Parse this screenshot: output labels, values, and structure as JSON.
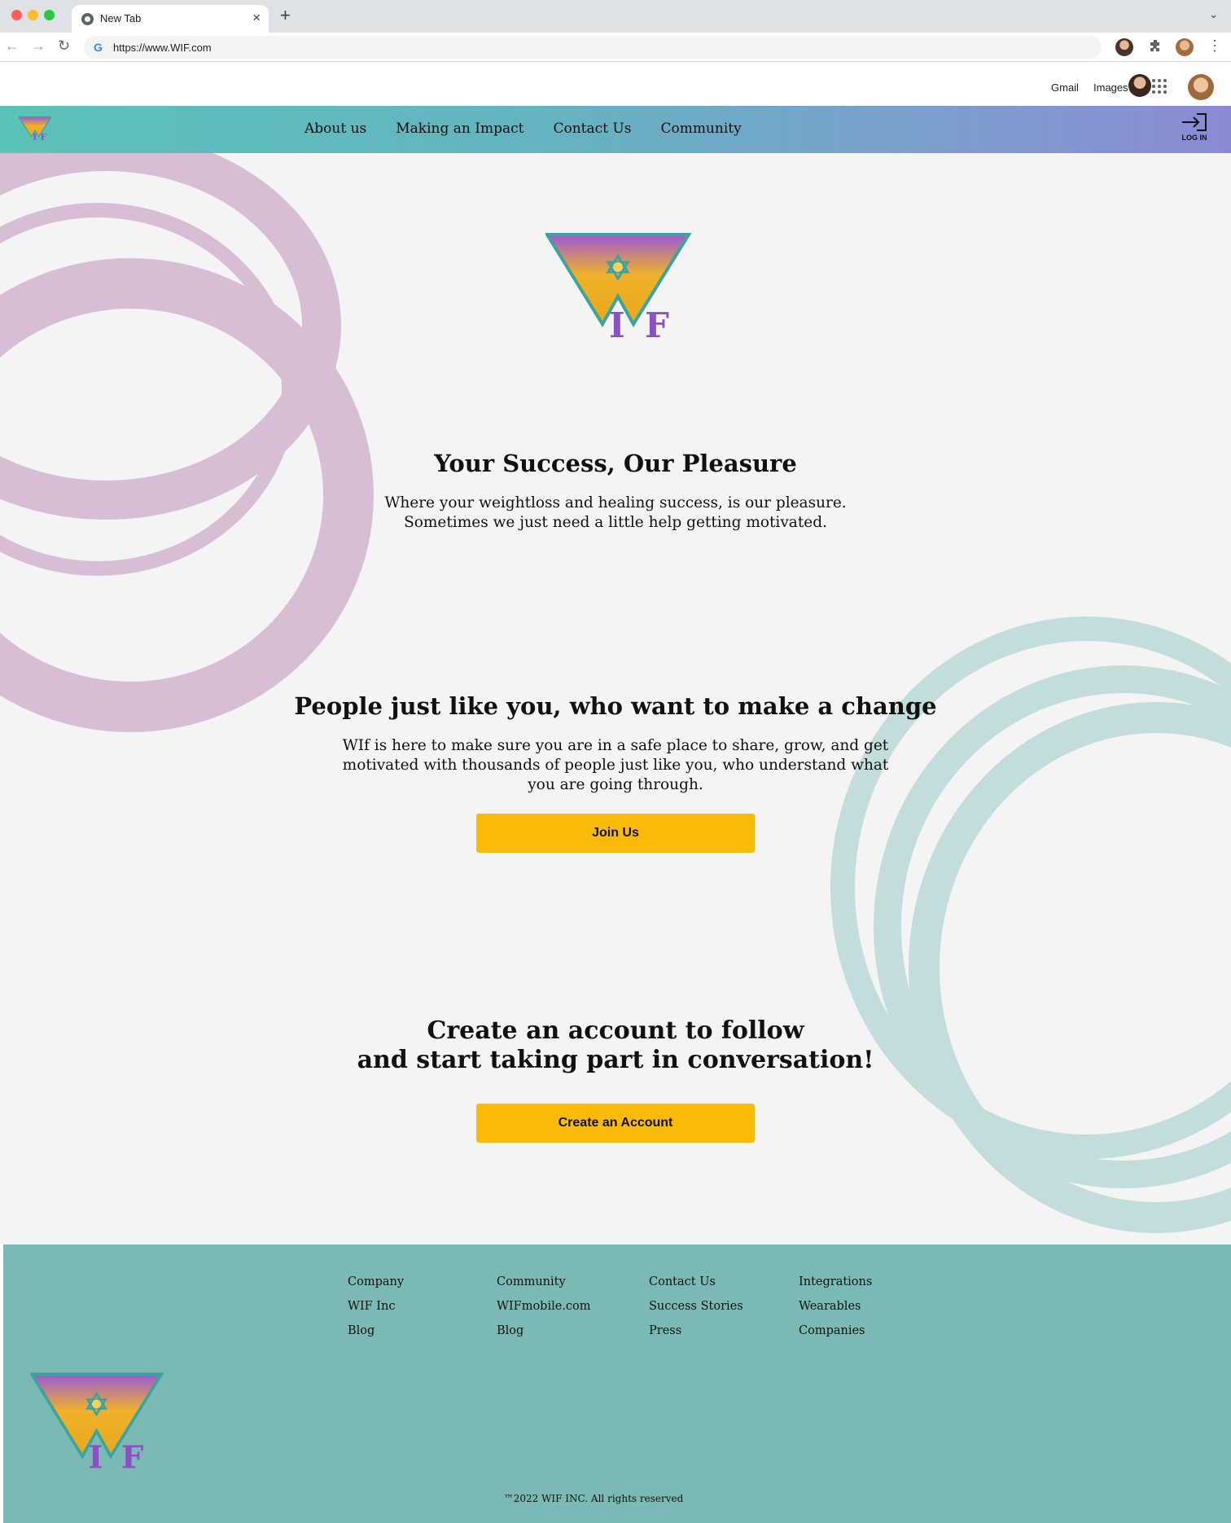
{
  "browser": {
    "tab_title": "New Tab",
    "tab_close": "×",
    "new_tab": "+",
    "tab_dropdown": "⌄",
    "back": "←",
    "forward": "→",
    "reload": "↻",
    "omnibox_icon": "G",
    "url": "https://www.WIF.com",
    "menu": "⋮"
  },
  "google_bar": {
    "gmail": "Gmail",
    "images": "Images"
  },
  "nav": {
    "links": [
      "About us",
      "Making an Impact",
      "Contact Us",
      "Community"
    ],
    "login": "LOG IN"
  },
  "logo": {
    "letter_i": "I",
    "letter_f": "F"
  },
  "hero": {
    "title": "Your Success, Our Pleasure",
    "text": "Where your weightloss and healing success, is our pleasure.\nSometimes we just need a little help getting motivated."
  },
  "community_section": {
    "title": "People just like you, who want to make a change",
    "text": "WIf is here to make sure you are in a safe place to share, grow, and get motivated with thousands of people just like you, who understand what you are going through.",
    "button": "Join Us"
  },
  "account_section": {
    "title": "Create an account to follow\nand start taking part in conversation!",
    "button": "Create an Account"
  },
  "footer": {
    "columns": [
      [
        "Company",
        "WIF Inc",
        "Blog"
      ],
      [
        "Community",
        "WIFmobile.com",
        "Blog"
      ],
      [
        "Contact Us",
        "Success Stories",
        "Press"
      ],
      [
        "Integrations",
        "Wearables",
        "Companies"
      ]
    ],
    "copyright": "™2022 WIF INC. All rights reserved"
  },
  "colors": {
    "nav_gradient_start": "#5bc2b8",
    "nav_gradient_end": "#8a8ad4",
    "button": "#f9bb07",
    "footer": "#7bb9b5",
    "ring_purple": "#d6bed5",
    "ring_teal": "#c3dddc"
  }
}
